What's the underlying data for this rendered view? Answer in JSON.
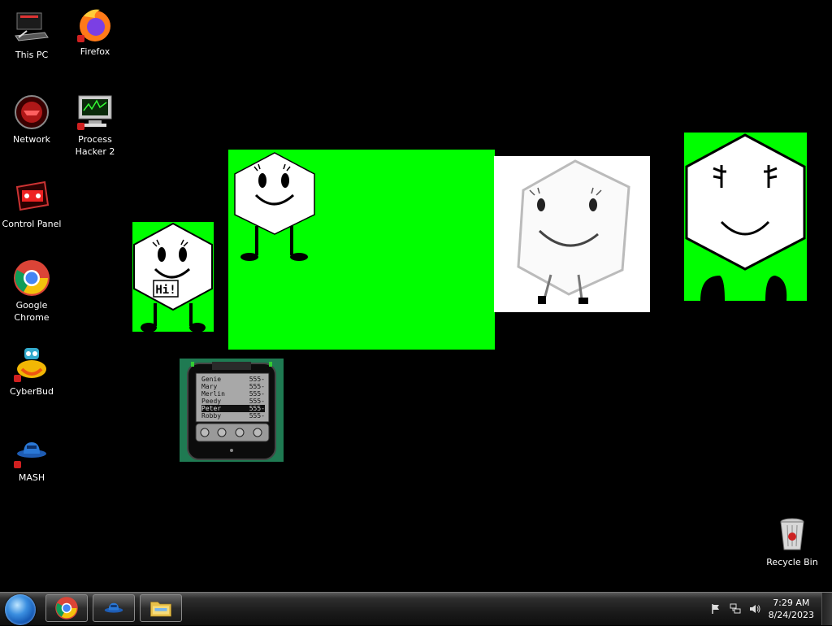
{
  "desktop": {
    "icons": [
      {
        "label": "This PC"
      },
      {
        "label": "Firefox"
      },
      {
        "label": "Network"
      },
      {
        "label": "Process Hacker 2"
      },
      {
        "label": "Control Panel"
      },
      {
        "label": "Google Chrome"
      },
      {
        "label": "CyberBud"
      },
      {
        "label": "MASH"
      },
      {
        "label": "Recycle Bin"
      }
    ],
    "pager_contacts": [
      {
        "name": "Genie",
        "num": "555-"
      },
      {
        "name": "Mary",
        "num": "555-"
      },
      {
        "name": "Merlin",
        "num": "555-"
      },
      {
        "name": "Peedy",
        "num": "555-"
      },
      {
        "name": "Peter",
        "num": "555-"
      },
      {
        "name": "Robby",
        "num": "555-"
      }
    ],
    "speech_bubble": "Hi!",
    "colors": {
      "green_screen": "#00ff00",
      "desktop_bg": "#000000"
    }
  },
  "taskbar": {
    "pinned": [
      "chrome-icon",
      "mash-icon",
      "file-explorer-icon"
    ],
    "clock": {
      "time": "7:29 AM",
      "date": "8/24/2023"
    }
  }
}
